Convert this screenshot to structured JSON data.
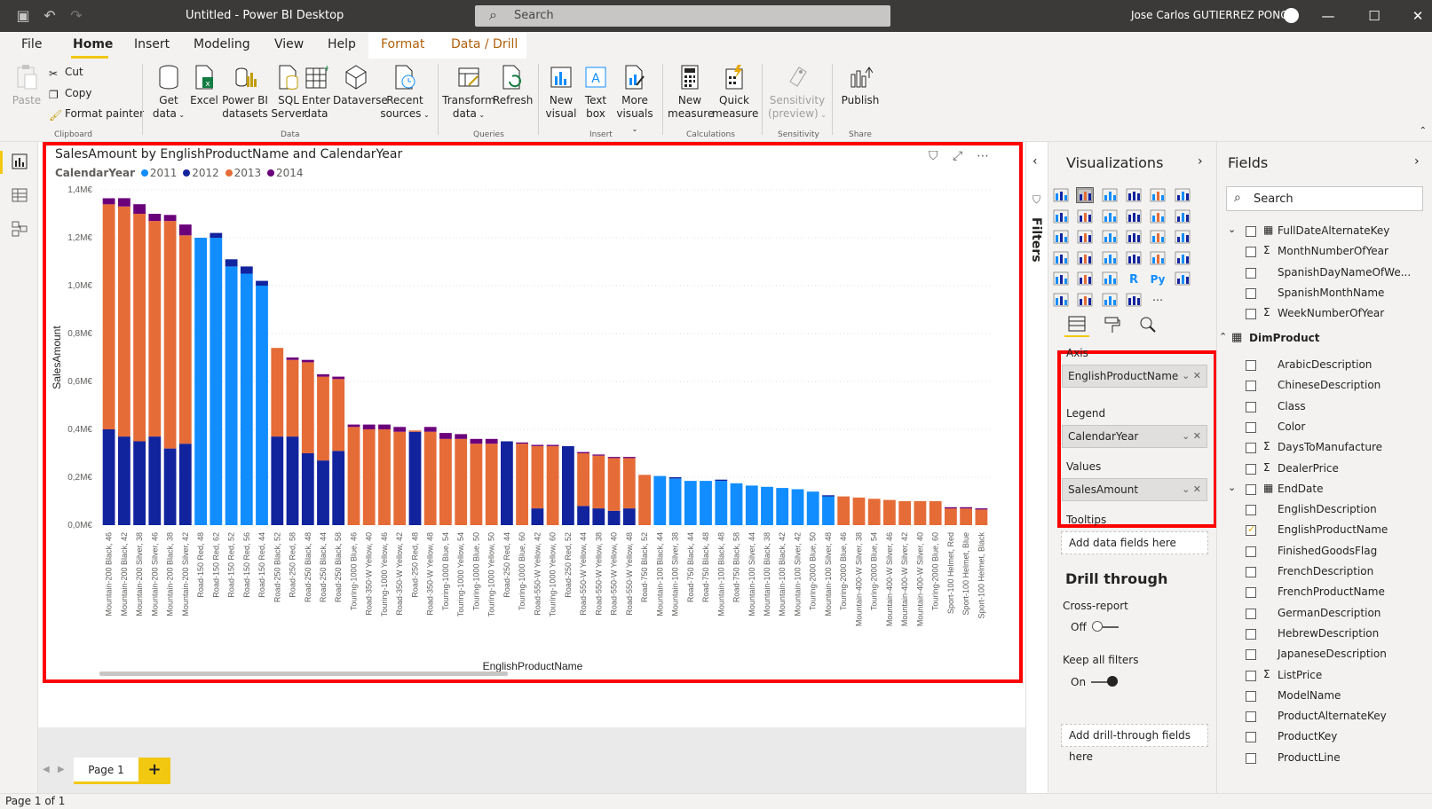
{
  "window": {
    "title": "Untitled - Power BI Desktop",
    "search_placeholder": "Search",
    "user": "Jose Carlos GUTIERREZ PONCE",
    "controls": [
      "minimize",
      "maximize",
      "close"
    ]
  },
  "menu": {
    "tabs": [
      "File",
      "Home",
      "Insert",
      "Modeling",
      "View",
      "Help",
      "Format",
      "Data / Drill"
    ],
    "active": "Home"
  },
  "ribbon": {
    "clipboard": {
      "paste": "Paste",
      "cut": "Cut",
      "copy": "Copy",
      "format_painter": "Format painter",
      "group": "Clipboard"
    },
    "data": {
      "get_data_1": "Get",
      "get_data_2": "data",
      "excel": "Excel",
      "pbi_1": "Power BI",
      "pbi_2": "datasets",
      "sql_1": "SQL",
      "sql_2": "Server",
      "enter_1": "Enter",
      "enter_2": "data",
      "dataverse": "Dataverse",
      "recent_1": "Recent",
      "recent_2": "sources",
      "group": "Data"
    },
    "queries": {
      "transform_1": "Transform",
      "transform_2": "data",
      "refresh": "Refresh",
      "group": "Queries"
    },
    "insert": {
      "new_visual_1": "New",
      "new_visual_2": "visual",
      "text_box_1": "Text",
      "text_box_2": "box",
      "more_visuals_1": "More",
      "more_visuals_2": "visuals",
      "group": "Insert"
    },
    "calculations": {
      "new_measure_1": "New",
      "new_measure_2": "measure",
      "quick_measure_1": "Quick",
      "quick_measure_2": "measure",
      "group": "Calculations"
    },
    "sensitivity": {
      "label_1": "Sensitivity",
      "label_2": "(preview)",
      "group": "Sensitivity"
    },
    "share": {
      "publish": "Publish",
      "group": "Share"
    }
  },
  "visual": {
    "title": "SalesAmount by EnglishProductName and CalendarYear",
    "legend_title": "CalendarYear"
  },
  "chart_data": {
    "type": "bar",
    "stacked": true,
    "xlabel": "EnglishProductName",
    "ylabel": "SalesAmount",
    "ylim": [
      0,
      1.4
    ],
    "yticks": [
      "0,0M€",
      "0,2M€",
      "0,4M€",
      "0,6M€",
      "0,8M€",
      "1,0M€",
      "1,2M€",
      "1,4M€"
    ],
    "y_unit": "M€",
    "grid": true,
    "legend_position": "top-left",
    "categories": [
      "Mountain-200 Black, 46",
      "Mountain-200 Black, 42",
      "Mountain-200 Silver, 38",
      "Mountain-200 Silver, 46",
      "Mountain-200 Black, 38",
      "Mountain-200 Silver, 42",
      "Road-150 Red, 48",
      "Road-150 Red, 62",
      "Road-150 Red, 52",
      "Road-150 Red, 56",
      "Road-150 Red, 44",
      "Road-250 Black, 52",
      "Road-250 Red, 58",
      "Road-250 Black, 48",
      "Road-250 Black, 44",
      "Road-250 Black, 58",
      "Touring-1000 Blue, 46",
      "Road-350-W Yellow, 40",
      "Touring-1000 Yellow, 46",
      "Road-350-W Yellow, 42",
      "Road-250 Red, 48",
      "Road-350-W Yellow, 48",
      "Touring-1000 Blue, 54",
      "Touring-1000 Yellow, 54",
      "Touring-1000 Blue, 50",
      "Touring-1000 Yellow, 50",
      "Road-250 Red, 44",
      "Touring-1000 Blue, 60",
      "Road-550-W Yellow, 42",
      "Touring-1000 Yellow, 60",
      "Road-250 Red, 52",
      "Road-550-W Yellow, 44",
      "Road-550-W Yellow, 38",
      "Road-550-W Yellow, 40",
      "Road-550-W Yellow, 48",
      "Road-750 Black, 52",
      "Mountain-100 Black, 44",
      "Mountain-100 Silver, 38",
      "Road-750 Black, 44",
      "Road-750 Black, 48",
      "Mountain-100 Black, 48",
      "Road-750 Black, 58",
      "Mountain-100 Silver, 44",
      "Mountain-100 Black, 38",
      "Mountain-100 Black, 42",
      "Mountain-100 Silver, 42",
      "Touring-2000 Blue, 50",
      "Mountain-100 Silver, 48",
      "Touring-2000 Blue, 46",
      "Mountain-400-W Silver, 38",
      "Touring-2000 Blue, 54",
      "Mountain-400-W Silver, 46",
      "Mountain-400-W Silver, 42",
      "Mountain-400-W Silver, 40",
      "Touring-2000 Blue, 60",
      "Sport-100 Helmet, Red",
      "Sport-100 Helmet, Blue",
      "Sport-100 Helmet, Black"
    ],
    "series": [
      {
        "name": "2011",
        "color": "#118dff",
        "values": [
          0,
          0,
          0,
          0,
          0,
          0,
          1.2,
          1.2,
          1.08,
          1.05,
          1.0,
          0,
          0,
          0,
          0,
          0,
          0,
          0,
          0,
          0,
          0,
          0,
          0,
          0,
          0,
          0,
          0,
          0,
          0,
          0,
          0,
          0,
          0,
          0,
          0,
          0,
          0.205,
          0.195,
          0.185,
          0.185,
          0.185,
          0.175,
          0.165,
          0.16,
          0.155,
          0.15,
          0.14,
          0.12,
          0,
          0,
          0,
          0,
          0,
          0,
          0,
          0,
          0,
          0
        ]
      },
      {
        "name": "2012",
        "color": "#12239e",
        "values": [
          0.4,
          0.37,
          0.35,
          0.37,
          0.32,
          0.34,
          0,
          0.02,
          0.03,
          0.03,
          0.02,
          0.37,
          0.37,
          0.3,
          0.27,
          0.31,
          0,
          0,
          0,
          0,
          0.39,
          0,
          0,
          0,
          0,
          0,
          0.35,
          0,
          0.07,
          0,
          0.33,
          0.08,
          0.07,
          0.06,
          0.07,
          0,
          0,
          0.005,
          0,
          0,
          0.005,
          0,
          0,
          0,
          0,
          0,
          0,
          0.005,
          0,
          0,
          0,
          0,
          0,
          0,
          0,
          0,
          0,
          0
        ]
      },
      {
        "name": "2013",
        "color": "#e66c37",
        "values": [
          0.94,
          0.96,
          0.95,
          0.9,
          0.95,
          0.87,
          0,
          0,
          0,
          0,
          0,
          0.37,
          0.32,
          0.38,
          0.35,
          0.3,
          0.41,
          0.4,
          0.4,
          0.39,
          0.005,
          0.39,
          0.36,
          0.36,
          0.34,
          0.34,
          0,
          0.34,
          0.26,
          0.33,
          0,
          0.22,
          0.22,
          0.22,
          0.21,
          0.21,
          0,
          0,
          0,
          0,
          0,
          0,
          0,
          0,
          0,
          0,
          0,
          0,
          0.12,
          0.115,
          0.11,
          0.105,
          0.1,
          0.1,
          0.1,
          0.07,
          0.07,
          0.065
        ]
      },
      {
        "name": "2014",
        "color": "#6b007b",
        "values": [
          0.025,
          0.035,
          0.04,
          0.03,
          0.025,
          0.045,
          0,
          0,
          0,
          0,
          0,
          0,
          0.01,
          0.01,
          0.01,
          0.01,
          0.01,
          0.02,
          0.02,
          0.02,
          0,
          0.02,
          0.025,
          0.02,
          0.02,
          0.02,
          0,
          0.005,
          0.005,
          0.005,
          0,
          0.005,
          0.005,
          0.005,
          0.005,
          0,
          0,
          0,
          0,
          0,
          0,
          0,
          0,
          0,
          0,
          0,
          0,
          0,
          0,
          0,
          0,
          0,
          0,
          0,
          0,
          0.005,
          0.005,
          0.005
        ]
      }
    ]
  },
  "filters_pane": {
    "label": "Filters"
  },
  "visualizations_pane": {
    "title": "Visualizations",
    "wells": {
      "axis_label": "Axis",
      "axis_value": "EnglishProductName",
      "legend_label": "Legend",
      "legend_value": "CalendarYear",
      "values_label": "Values",
      "values_value": "SalesAmount",
      "tooltips_label": "Tooltips",
      "tooltips_add": "Add data fields here"
    },
    "drill": {
      "title": "Drill through",
      "cross_report": "Cross-report",
      "cross_state": "Off",
      "keep_filters": "Keep all filters",
      "keep_state": "On",
      "add": "Add drill-through fields here"
    }
  },
  "fields_pane": {
    "title": "Fields",
    "search_placeholder": "Search",
    "items": [
      {
        "label": "FullDateAlternateKey",
        "kind": "date",
        "checked": false
      },
      {
        "label": "MonthNumberOfYear",
        "kind": "sum",
        "checked": false
      },
      {
        "label": "SpanishDayNameOfWe...",
        "kind": "text",
        "checked": false
      },
      {
        "label": "SpanishMonthName",
        "kind": "text",
        "checked": false
      },
      {
        "label": "WeekNumberOfYear",
        "kind": "sum",
        "checked": false
      }
    ],
    "table": "DimProduct",
    "table_items": [
      {
        "label": "ArabicDescription",
        "kind": "text",
        "checked": false
      },
      {
        "label": "ChineseDescription",
        "kind": "text",
        "checked": false
      },
      {
        "label": "Class",
        "kind": "text",
        "checked": false
      },
      {
        "label": "Color",
        "kind": "text",
        "checked": false
      },
      {
        "label": "DaysToManufacture",
        "kind": "sum",
        "checked": false
      },
      {
        "label": "DealerPrice",
        "kind": "sum",
        "checked": false
      },
      {
        "label": "EndDate",
        "kind": "date",
        "checked": false
      },
      {
        "label": "EnglishDescription",
        "kind": "text",
        "checked": false
      },
      {
        "label": "EnglishProductName",
        "kind": "text",
        "checked": true
      },
      {
        "label": "FinishedGoodsFlag",
        "kind": "text",
        "checked": false
      },
      {
        "label": "FrenchDescription",
        "kind": "text",
        "checked": false
      },
      {
        "label": "FrenchProductName",
        "kind": "text",
        "checked": false
      },
      {
        "label": "GermanDescription",
        "kind": "text",
        "checked": false
      },
      {
        "label": "HebrewDescription",
        "kind": "text",
        "checked": false
      },
      {
        "label": "JapaneseDescription",
        "kind": "text",
        "checked": false
      },
      {
        "label": "ListPrice",
        "kind": "sum",
        "checked": false
      },
      {
        "label": "ModelName",
        "kind": "text",
        "checked": false
      },
      {
        "label": "ProductAlternateKey",
        "kind": "text",
        "checked": false
      },
      {
        "label": "ProductKey",
        "kind": "text",
        "checked": false
      },
      {
        "label": "ProductLine",
        "kind": "text",
        "checked": false
      }
    ]
  },
  "pages": {
    "tab": "Page 1",
    "add": "+"
  },
  "status": {
    "text": "Page 1 of 1"
  },
  "colors": {
    "accent": "#f2c811",
    "highlight": "#ff0000",
    "titlebar": "#3b3a39"
  }
}
